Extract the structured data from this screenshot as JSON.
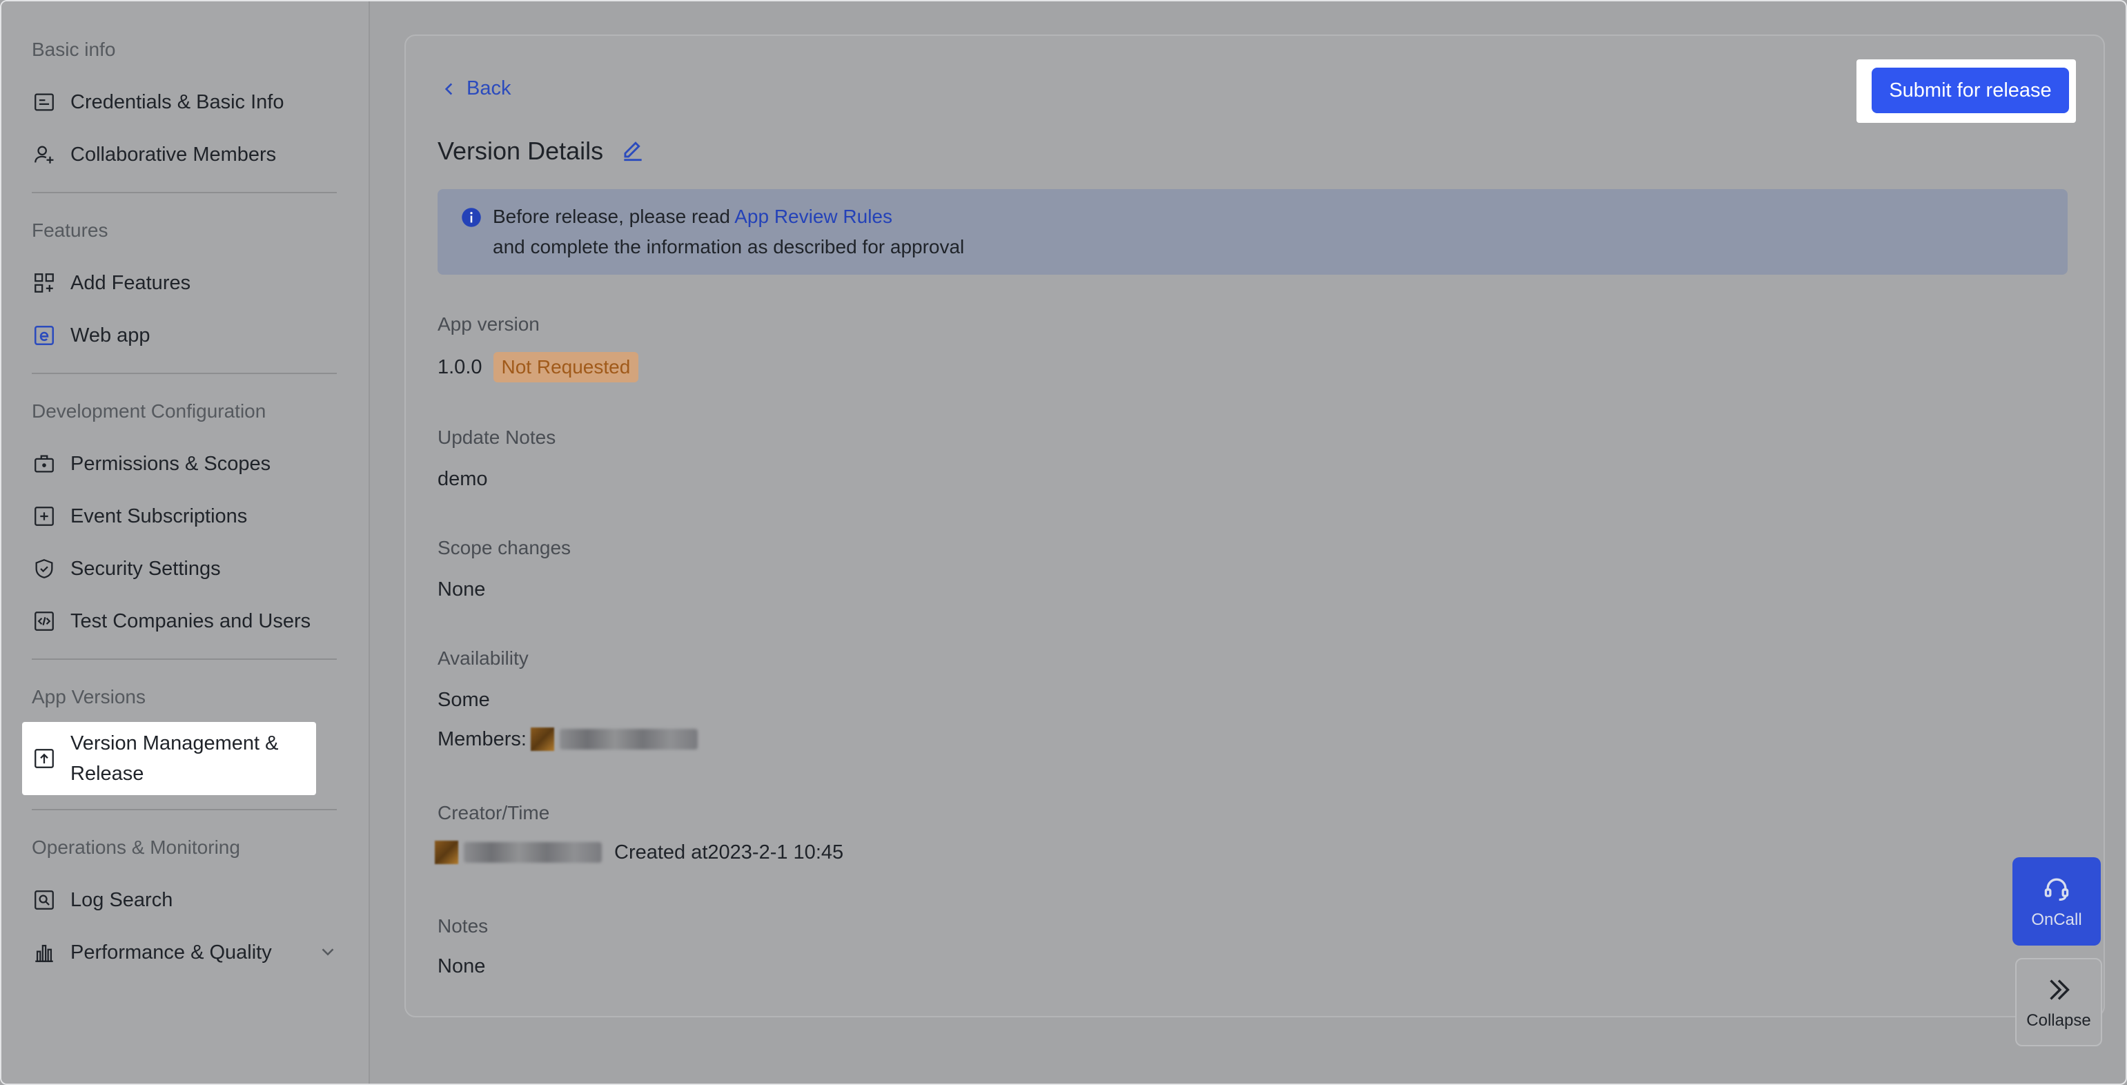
{
  "sidebar": {
    "groups": [
      {
        "title": "Basic info",
        "items": [
          {
            "label": "Credentials & Basic Info"
          },
          {
            "label": "Collaborative Members"
          }
        ]
      },
      {
        "title": "Features",
        "items": [
          {
            "label": "Add Features"
          },
          {
            "label": "Web app"
          }
        ]
      },
      {
        "title": "Development Configuration",
        "items": [
          {
            "label": "Permissions & Scopes"
          },
          {
            "label": "Event Subscriptions"
          },
          {
            "label": "Security Settings"
          },
          {
            "label": "Test Companies and Users"
          }
        ]
      },
      {
        "title": "App Versions",
        "items": [
          {
            "label": "Version Management & Release"
          }
        ]
      },
      {
        "title": "Operations & Monitoring",
        "items": [
          {
            "label": "Log Search"
          },
          {
            "label": "Performance & Quality"
          }
        ]
      }
    ]
  },
  "header": {
    "back_label": "Back",
    "submit_label": "Submit for release",
    "title": "Version Details"
  },
  "notice": {
    "prefix": "Before release, please read ",
    "link": "App Review Rules",
    "line2": "and complete the information as described for approval"
  },
  "fields": {
    "app_version": {
      "label": "App version",
      "value": "1.0.0",
      "status": "Not Requested"
    },
    "update_notes": {
      "label": "Update Notes",
      "value": "demo"
    },
    "scope_changes": {
      "label": "Scope changes",
      "value": "None"
    },
    "availability": {
      "label": "Availability",
      "value": "Some",
      "members_label": "Members:"
    },
    "creator": {
      "label": "Creator/Time",
      "created": "Created at2023-2-1 10:45"
    },
    "notes": {
      "label": "Notes",
      "value": "None"
    }
  },
  "floating": {
    "oncall_label": "OnCall",
    "collapse_label": "Collapse"
  },
  "colors": {
    "primary": "#3056f0",
    "link": "#2442b8",
    "badge_text": "#a05a1a",
    "badge_bg": "#d3a47c"
  }
}
